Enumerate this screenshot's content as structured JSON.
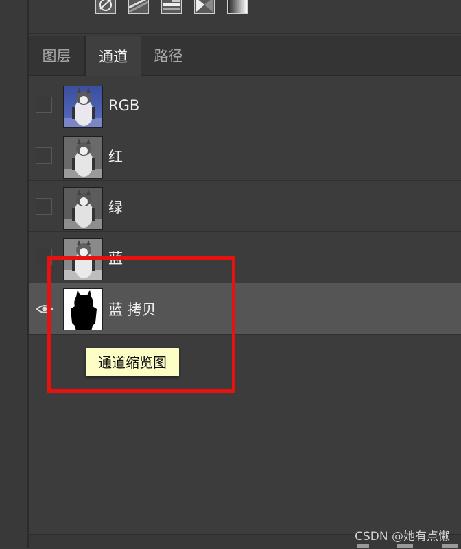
{
  "tabs": [
    {
      "label": "图层",
      "active": false
    },
    {
      "label": "通道",
      "active": true
    },
    {
      "label": "路径",
      "active": false
    }
  ],
  "adjustment_icons": [
    "exposure-icon",
    "gradient-map-icon",
    "posterize-icon",
    "threshold-icon",
    "gradient-icon"
  ],
  "channels": [
    {
      "label": "RGB",
      "visible": false,
      "thumb": "color-penguin"
    },
    {
      "label": "红",
      "visible": false,
      "thumb": "gray-penguin"
    },
    {
      "label": "绿",
      "visible": false,
      "thumb": "gray-penguin"
    },
    {
      "label": "蓝",
      "visible": false,
      "thumb": "gray-penguin"
    },
    {
      "label": "蓝 拷贝",
      "visible": true,
      "selected": true,
      "thumb": "mask-silhouette"
    }
  ],
  "tooltip": "通道缩览图",
  "watermark": "CSDN @她有点懒",
  "colors": {
    "panel": "#3c3c3c",
    "selected_row": "#555555",
    "highlight": "#e8110d",
    "tooltip_bg": "#fdfdc6"
  }
}
